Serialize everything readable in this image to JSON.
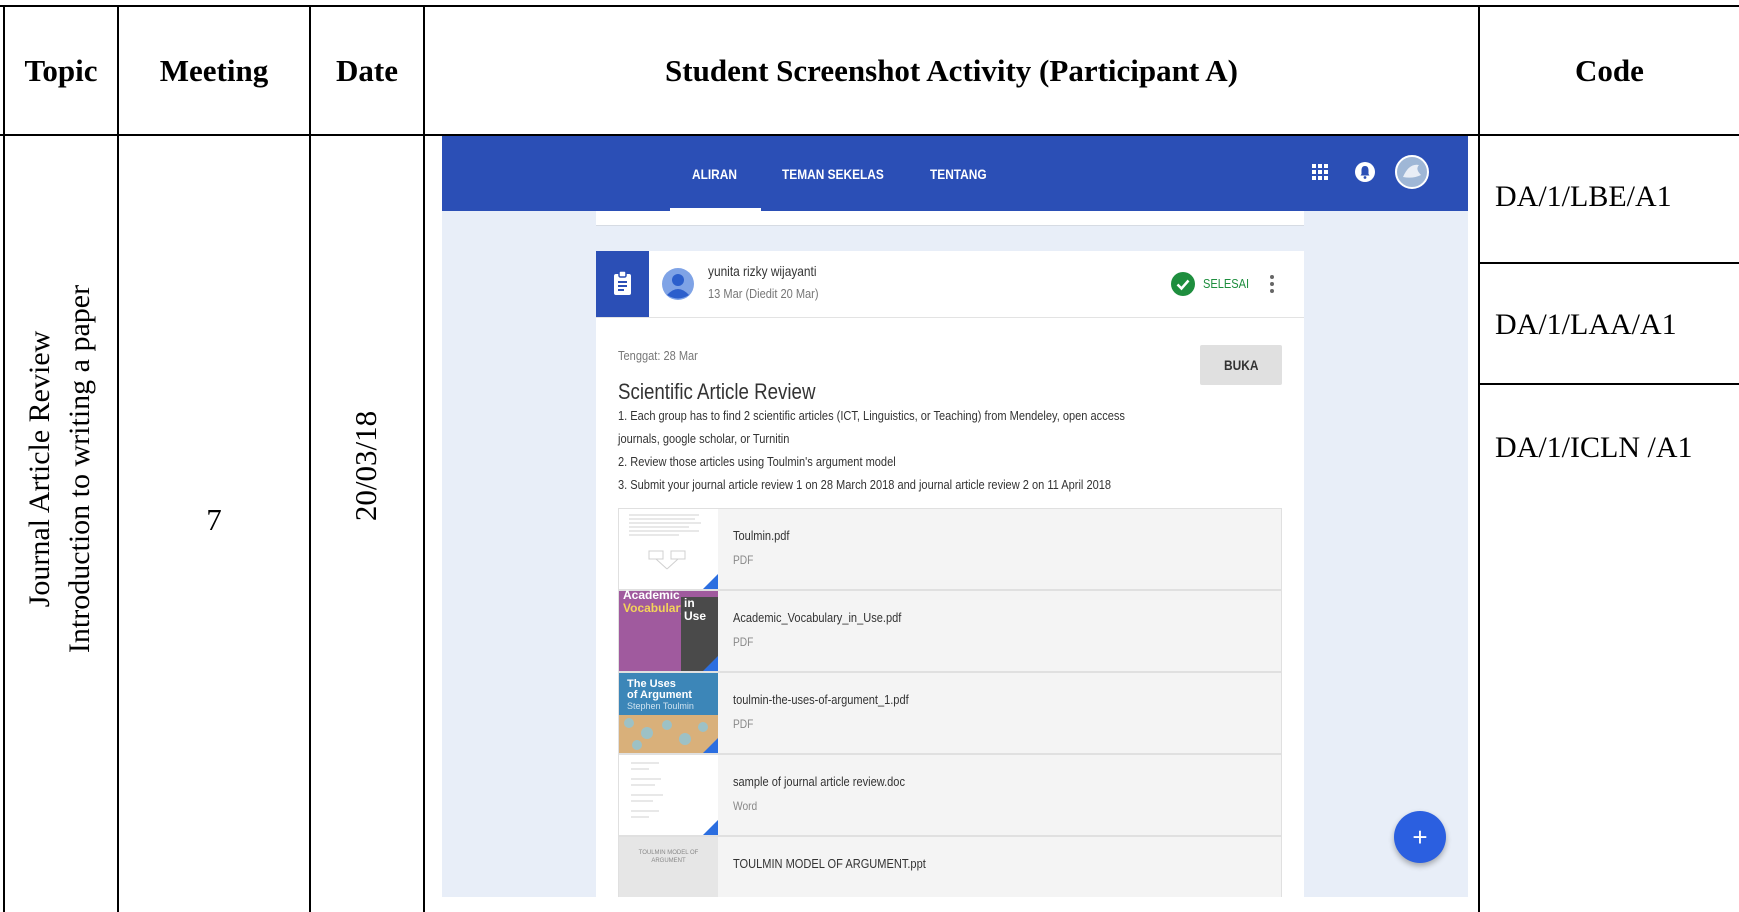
{
  "table": {
    "headers": {
      "topic": "Topic",
      "meeting": "Meeting",
      "date": "Date",
      "activity": "Student Screenshot Activity (Participant A)",
      "code": "Code"
    },
    "row": {
      "topic_line1": "Journal Article Review",
      "topic_line2": "Introduction to writing a paper",
      "meeting": "7",
      "date": "20/03/18",
      "codes": [
        "DA/1/LBE/A1",
        "DA/1/LAA/A1",
        "DA/1/ICLN /A1"
      ]
    }
  },
  "screenshot": {
    "tabs": [
      "ALIRAN",
      "TEMAN SEKELAS",
      "TENTANG"
    ],
    "active_tab": "ALIRAN",
    "icons": [
      "apps-grid-icon",
      "notifications-icon",
      "avatar"
    ],
    "post": {
      "author": "yunita rizky wijayanti",
      "date": "13 Mar (Diedit 20 Mar)",
      "status": "SELESAI",
      "due": "Tenggat: 28 Mar",
      "open_button": "BUKA",
      "title": "Scientific Article Review",
      "instructions": [
        "1. Each group has to find 2 scientific articles (ICT, Linguistics, or Teaching) from Mendeley, open access",
        "journals, google scholar, or Turnitin",
        "2. Review those articles using Toulmin's argument model",
        "3. Submit your journal article review 1 on 28 March 2018 and journal article review 2 on 11 April 2018"
      ],
      "attachments": [
        {
          "name": "Toulmin.pdf",
          "type": "PDF"
        },
        {
          "name": "Academic_Vocabulary_in_Use.pdf",
          "type": "PDF",
          "thumb_text": [
            "Academic",
            "Vocabulary",
            "in",
            "Use"
          ]
        },
        {
          "name": "toulmin-the-uses-of-argument_1.pdf",
          "type": "PDF",
          "thumb_text": [
            "The Uses",
            "of Argument",
            "Stephen Toulmin"
          ]
        },
        {
          "name": "sample of journal article review.doc",
          "type": "Word"
        },
        {
          "name": "TOULMIN MODEL OF ARGUMENT.ppt",
          "type": "",
          "thumb_text": [
            "TOULMIN MODEL OF",
            "ARGUMENT"
          ]
        }
      ]
    },
    "fab": "+",
    "colors": {
      "bar": "#2b4fb6",
      "status_green": "#1e8e3e",
      "fab": "#2b5fe0",
      "background": "#e8eef8"
    }
  }
}
